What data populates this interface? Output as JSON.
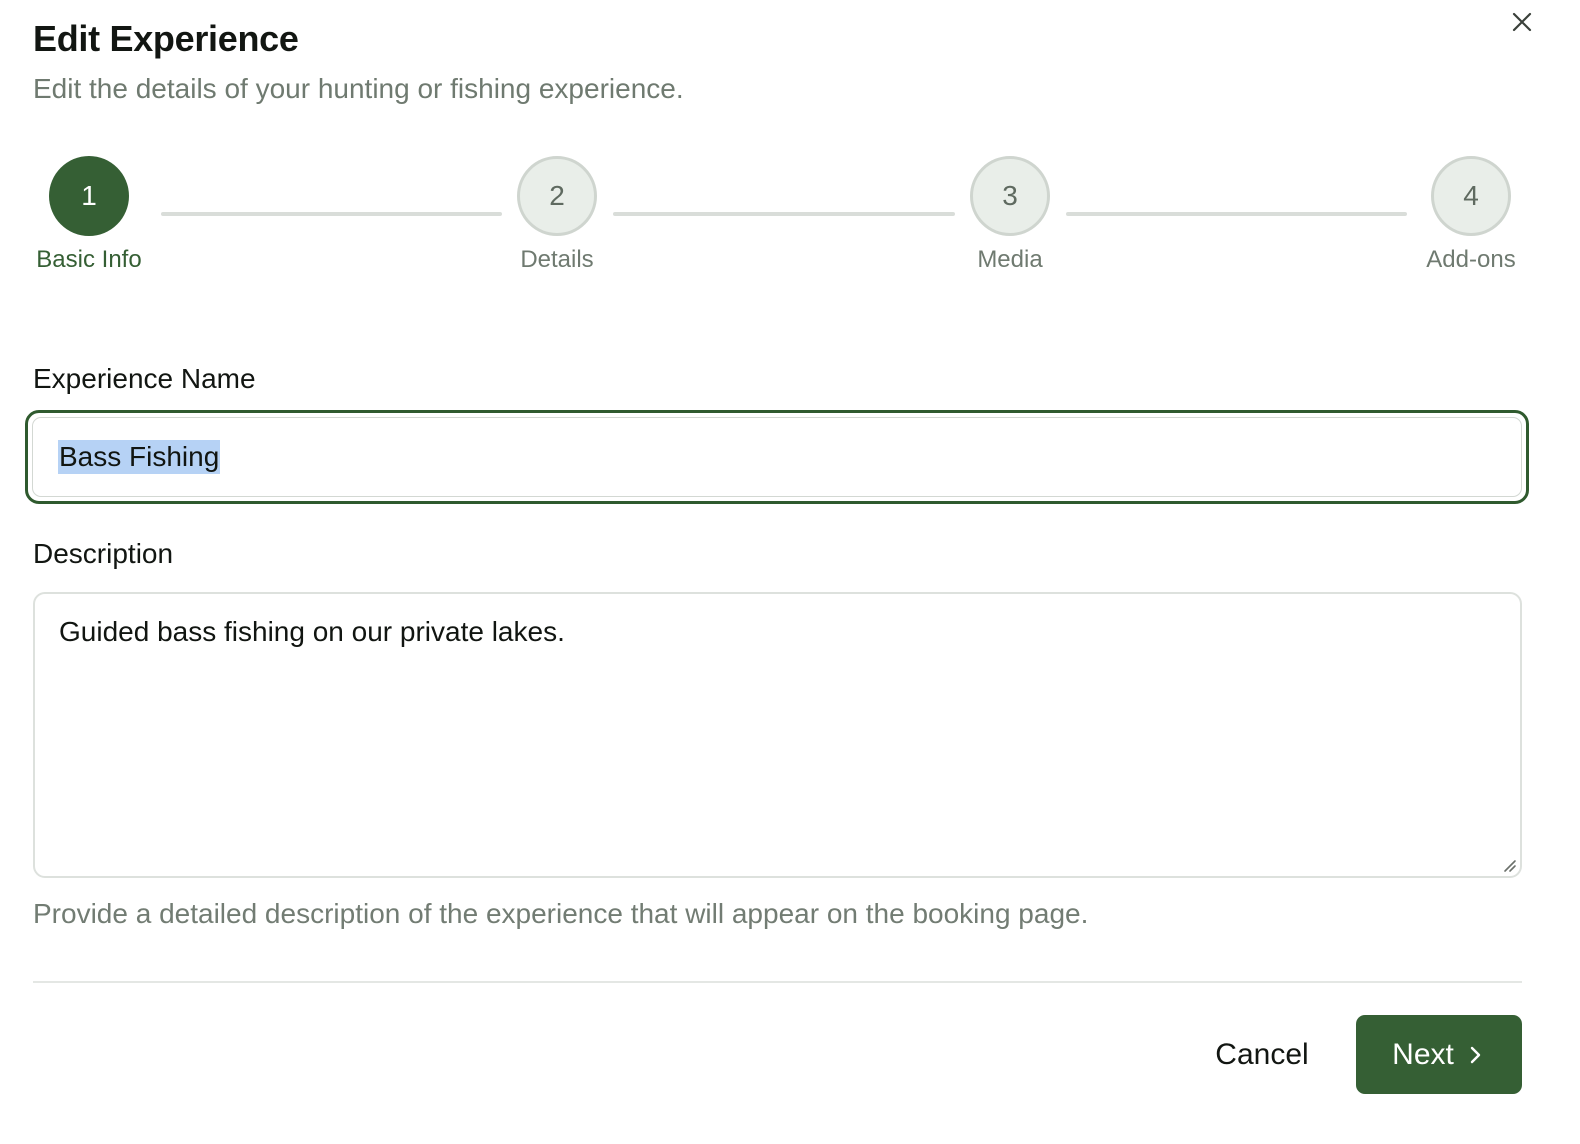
{
  "dialog": {
    "title": "Edit Experience",
    "subtitle": "Edit the details of your hunting or fishing experience.",
    "close_icon": "close-icon"
  },
  "stepper": {
    "steps": [
      {
        "number": "1",
        "label": "Basic Info",
        "state": "active"
      },
      {
        "number": "2",
        "label": "Details",
        "state": "inactive"
      },
      {
        "number": "3",
        "label": "Media",
        "state": "inactive"
      },
      {
        "number": "4",
        "label": "Add-ons",
        "state": "inactive"
      }
    ]
  },
  "form": {
    "name": {
      "label": "Experience Name",
      "value": "Bass Fishing",
      "selected": true
    },
    "description": {
      "label": "Description",
      "value": "Guided bass fishing on our private lakes.",
      "helper": "Provide a detailed description of the experience that will appear on the booking page."
    }
  },
  "footer": {
    "cancel_label": "Cancel",
    "next_label": "Next",
    "next_icon": "chevron-right-icon"
  },
  "colors": {
    "accent": "#355f34",
    "selection": "#b6d2f5",
    "muted_text": "#6f7a70"
  }
}
